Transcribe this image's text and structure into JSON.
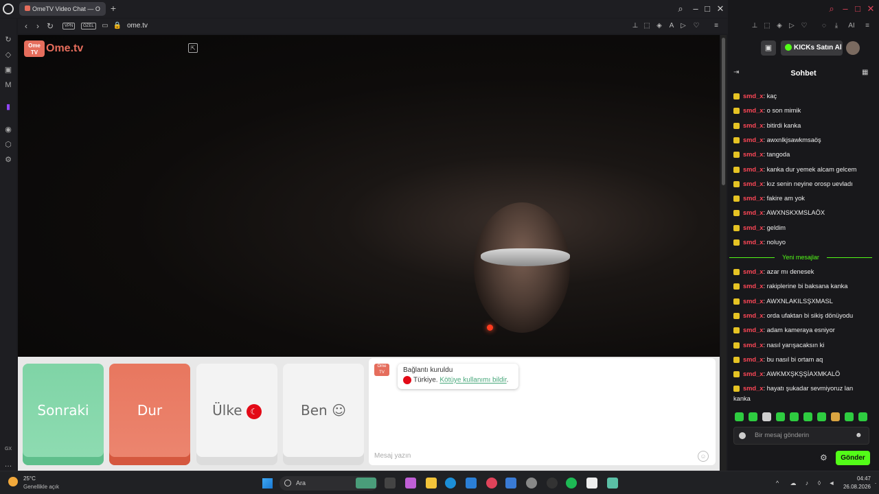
{
  "browser": {
    "tab_title": "OmeTV Video Chat — O",
    "url": "ome.tv",
    "vpn": "VPN",
    "private": "ÖZEL"
  },
  "ometv": {
    "logo_box": "Ome TV",
    "logo_text": "Ome.tv",
    "buttons": {
      "next": "Sonraki",
      "stop": "Dur",
      "country": "Ülke",
      "me": "Ben"
    },
    "connection": {
      "status": "Bağlantı kuruldu",
      "country": "Türkiye.",
      "report": "Kötüye kullanımı bildir",
      "report_suffix": "."
    },
    "message_placeholder": "Mesaj yazın"
  },
  "kick": {
    "buy_kicks": "KICKs Satın Al",
    "chat_title": "Sohbet",
    "messages_before": [
      {
        "user": "smd_x",
        "text": "kaç"
      },
      {
        "user": "smd_x",
        "text": "o son mimik"
      },
      {
        "user": "smd_x",
        "text": "bitirdi kanka"
      },
      {
        "user": "smd_x",
        "text": "awxnlkjsawkmsaöş"
      },
      {
        "user": "smd_x",
        "text": "tangoda"
      },
      {
        "user": "smd_x",
        "text": "kanka dur yemek alcam gelcem"
      },
      {
        "user": "smd_x",
        "text": "kız senin neyine orosp uevladı"
      },
      {
        "user": "smd_x",
        "text": "fakire am yok"
      },
      {
        "user": "smd_x",
        "text": "AWXNSKXMSLAÖX"
      },
      {
        "user": "smd_x",
        "text": "geldim"
      },
      {
        "user": "smd_x",
        "text": "noluyo"
      }
    ],
    "new_messages_label": "Yeni mesajlar",
    "messages_after": [
      {
        "user": "smd_x",
        "text": "azar mı denesek"
      },
      {
        "user": "smd_x",
        "text": "rakiplerine bi baksana kanka"
      },
      {
        "user": "smd_x",
        "text": "AWXNLAKILSŞXMASL"
      },
      {
        "user": "smd_x",
        "text": "orda ufaktan bi sikiş dönüyodu"
      },
      {
        "user": "smd_x",
        "text": "adam kameraya esniyor"
      },
      {
        "user": "smd_x",
        "text": "nasıl yarışacaksın ki"
      },
      {
        "user": "smd_x",
        "text": "bu nasıl bi ortam aq"
      },
      {
        "user": "smd_x",
        "text": "AWKMXŞKŞŞİAXMKALÖ"
      },
      {
        "user": "smd_x",
        "text": "hayatı şukadar sevmiyoruz lan"
      }
    ],
    "last_line_wrap": "kanka",
    "input_placeholder": "Bir mesaj gönderin",
    "send_label": "Gönder",
    "accent": "#53fc18",
    "username_color": "#ff4757"
  },
  "taskbar": {
    "temp": "25°C",
    "weather": "Genellikle açık",
    "search": "Ara",
    "time": "04:47",
    "date": "26.08.2026"
  }
}
